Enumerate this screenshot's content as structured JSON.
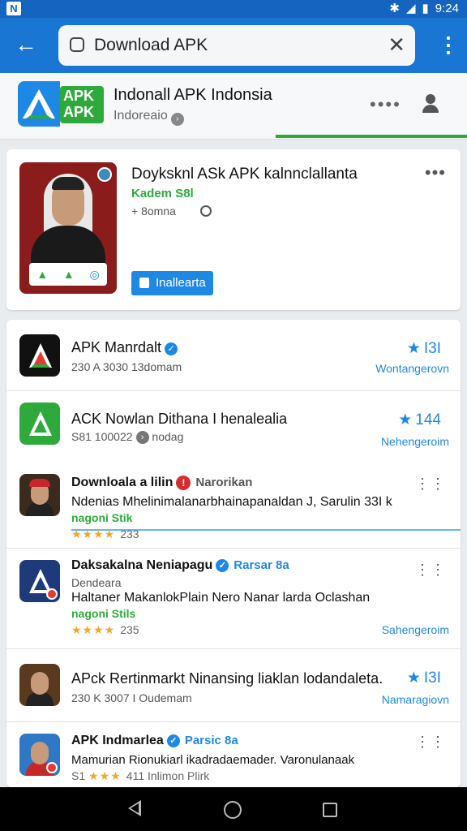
{
  "status": {
    "time": "9:24",
    "icons": [
      "bluetooth-icon",
      "signal-icon",
      "battery-icon"
    ]
  },
  "search": {
    "query": "Download APK"
  },
  "header": {
    "title": "Indonall APK Indonsia",
    "subtitle": "Indoreaio",
    "logo_text": "APK APK"
  },
  "featured": {
    "title": "Doyksknl ASk APK kalnnclallanta",
    "subtitle": "Kadem S8l",
    "meta": "+ 8omna",
    "button": "Inallearta"
  },
  "list": [
    {
      "title": "APK Manrdalt",
      "sub": "230 A 3030 13domam",
      "rating": "I3I",
      "link": "Wontangerovn"
    },
    {
      "title": "ACK Nowlan Dithana I henalealia",
      "sub": "S81 100022",
      "sub2": "nodag",
      "rating": "144",
      "link": "Nehengeroim"
    },
    {
      "title": "Downloala a lilin",
      "tag": "Narorikan",
      "desc": "Ndenias Mhelinimalanarbhainapanaldan J, Sarulin 33I k",
      "label": "nagoni Stik",
      "stars": "★★★★",
      "count": "233"
    },
    {
      "title": "Daksakalna Neniapagu",
      "tag": "Rarsar 8a",
      "sub": "Dendeara",
      "desc": "Haltaner MakanlokPlain Nero Nanar larda Oclashan",
      "label": "nagoni Stils",
      "stars": "★★★★",
      "count": "235",
      "link": "Sahengeroim"
    },
    {
      "title": "APck Rertinmarkt Ninansing liaklan lodandaleta.",
      "sub": "230 K 3007 I Oudemam",
      "rating": "I3I",
      "link": "Namaragiovn"
    },
    {
      "title": "APK Indmarlea",
      "tag": "Parsic 8a",
      "desc": "Mamurian Rionukiarl ikadradaemader. Varonulanaak",
      "sub": "S1",
      "stars": "★★★",
      "count": "411 Inlimon Plirk"
    }
  ]
}
